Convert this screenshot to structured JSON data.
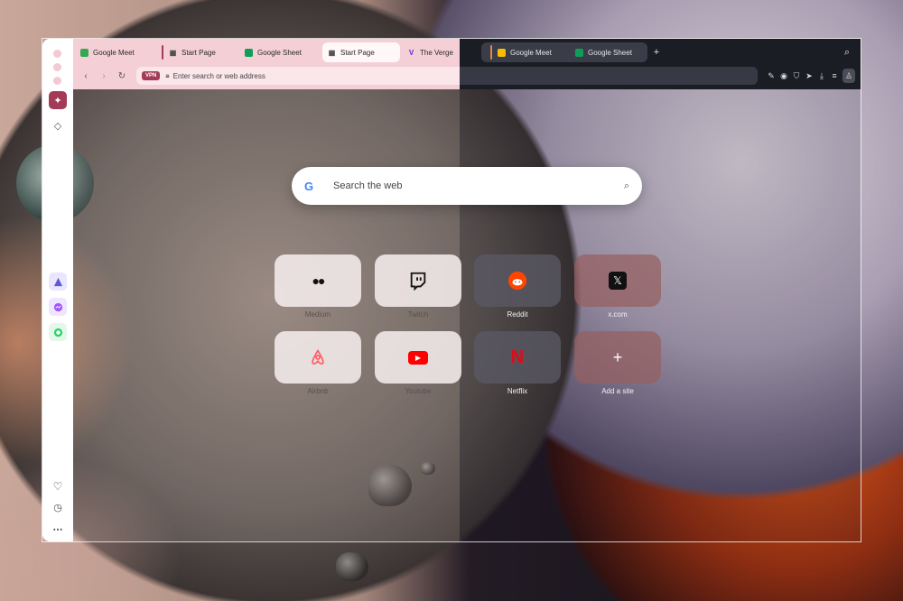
{
  "tabs_light": [
    {
      "label": "Google Meet"
    },
    {
      "label": "Start Page"
    },
    {
      "label": "Google Sheet"
    },
    {
      "label": "Start Page"
    },
    {
      "label": "The Verge"
    }
  ],
  "tabs_dark": [
    {
      "label": "Google Meet"
    },
    {
      "label": "Google Sheet"
    }
  ],
  "address": {
    "vpn_label": "VPN",
    "placeholder": "Enter search or web address"
  },
  "search": {
    "placeholder": "Search the web",
    "logo": "G"
  },
  "speed_dials": [
    {
      "label": "Medium",
      "icon": "●●"
    },
    {
      "label": "Twitch",
      "icon": ""
    },
    {
      "label": "Reddit",
      "icon": ""
    },
    {
      "label": "x.com",
      "icon": "𝕏"
    },
    {
      "label": "Airbnb",
      "icon": ""
    },
    {
      "label": "Youtube",
      "icon": "▶"
    },
    {
      "label": "Netflix",
      "icon": "N"
    },
    {
      "label": "Add a site",
      "icon": "+"
    }
  ],
  "colors": {
    "accent": "#a33a56",
    "light_chrome": "#f4cfd6",
    "dark_chrome": "#1b1d24"
  }
}
